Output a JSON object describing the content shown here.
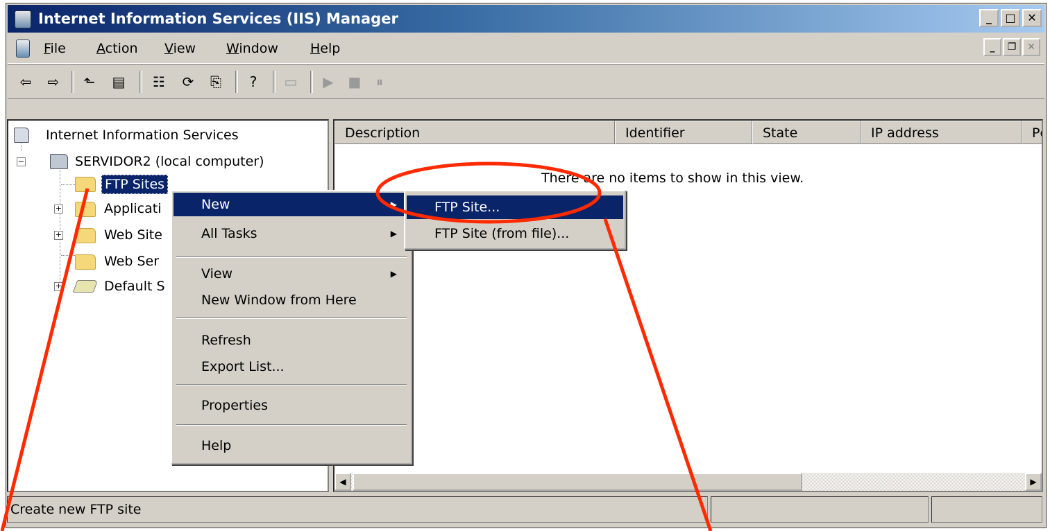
{
  "window": {
    "title": "Internet Information Services (IIS) Manager"
  },
  "caption_buttons": [
    "minimize",
    "maximize",
    "close"
  ],
  "menubar": {
    "items": [
      "File",
      "Action",
      "View",
      "Window",
      "Help"
    ]
  },
  "toolbar": {
    "buttons": [
      "back-icon",
      "forward-icon",
      "up-level-icon",
      "show-hide-tree-icon",
      "properties-icon",
      "refresh-icon",
      "export-list-icon",
      "help-icon",
      "computer-icon",
      "play-icon",
      "stop-icon",
      "pause-icon"
    ]
  },
  "tree": {
    "root": "Internet Information Services",
    "server": "SERVIDOR2 (local computer)",
    "children": [
      "FTP Sites",
      "Applicati",
      "Web Site",
      "Web Ser",
      "Default S"
    ]
  },
  "list": {
    "columns": [
      "Description",
      "Identifier",
      "State",
      "IP address",
      "Pc"
    ],
    "empty_message": "There are no items to show in this view."
  },
  "context_menu": {
    "items": [
      "New",
      "All Tasks",
      "View",
      "New Window from Here",
      "Refresh",
      "Export List...",
      "Properties",
      "Help"
    ]
  },
  "submenu": {
    "items": [
      "FTP Site...",
      "FTP Site (from file)..."
    ]
  },
  "statusbar": {
    "text": "Create new FTP site"
  },
  "colors": {
    "highlight": "#0a246a",
    "annotation": "#ff2a00",
    "titlebar": "#0a246a"
  }
}
